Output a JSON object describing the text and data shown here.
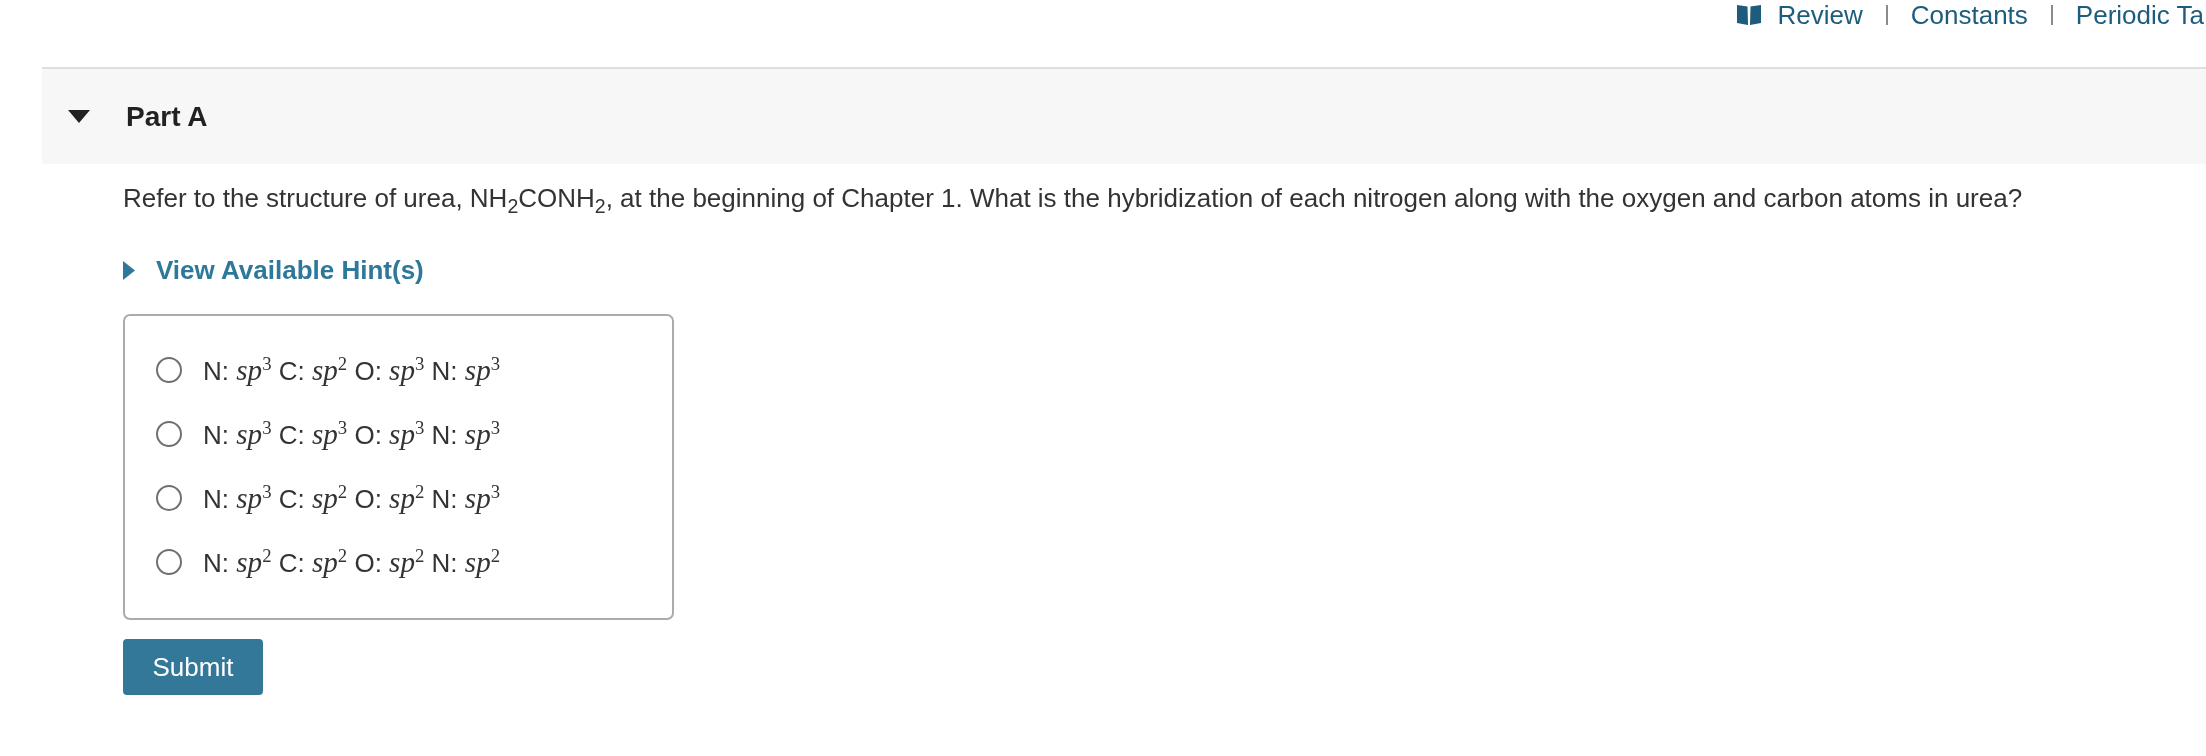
{
  "toolbar": {
    "links": [
      {
        "kind": "book",
        "label": "Review"
      },
      {
        "kind": "plain",
        "label": "Constants"
      },
      {
        "kind": "plain",
        "label": "Periodic Ta"
      }
    ]
  },
  "part": {
    "title": "Part A",
    "expanded": true
  },
  "question": {
    "text": "Refer to the structure of urea, NH$_{2}$CONH$_{2}$, at the beginning of Chapter 1. What is the hybridization of each nitrogen along with the oxygen and carbon atoms in urea?"
  },
  "hint": {
    "label": "View Available Hint(s)",
    "expanded": false
  },
  "options": [
    {
      "text": "N: *sp*$^{3}$ C: *sp*$^{2}$ O: *sp*$^{3}$ N: *sp*$^{3}$",
      "selected": false
    },
    {
      "text": "N: *sp*$^{3}$ C: *sp*$^{3}$ O: *sp*$^{3}$ N: *sp*$^{3}$",
      "selected": false
    },
    {
      "text": "N: *sp*$^{3}$ C: *sp*$^{2}$ O: *sp*$^{2}$ N: *sp*$^{3}$",
      "selected": false
    },
    {
      "text": "N: *sp*$^{2}$ C: *sp*$^{2}$ O: *sp*$^{2}$ N: *sp*$^{2}$",
      "selected": false
    }
  ],
  "submit": {
    "label": "Submit"
  }
}
